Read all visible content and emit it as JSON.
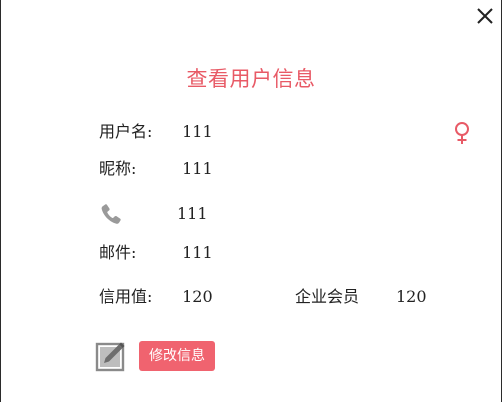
{
  "dialog": {
    "title": "查看用户信息",
    "close_icon": "close-icon"
  },
  "user": {
    "username_label": "用户名:",
    "username": "111",
    "gender_icon": "female-icon",
    "nickname_label": "昵称:",
    "nickname": "111",
    "phone_icon": "phone-icon",
    "phone": "111",
    "email_label": "邮件:",
    "email": "111",
    "credit_label": "信用值:",
    "credit": "120",
    "membership_label": "企业会员",
    "membership_value": "120"
  },
  "actions": {
    "edit_icon": "edit-icon",
    "edit_label": "修改信息"
  },
  "colors": {
    "accent": "#e85a66",
    "button": "#f0636f",
    "icon_gray": "#9a9a9a"
  }
}
